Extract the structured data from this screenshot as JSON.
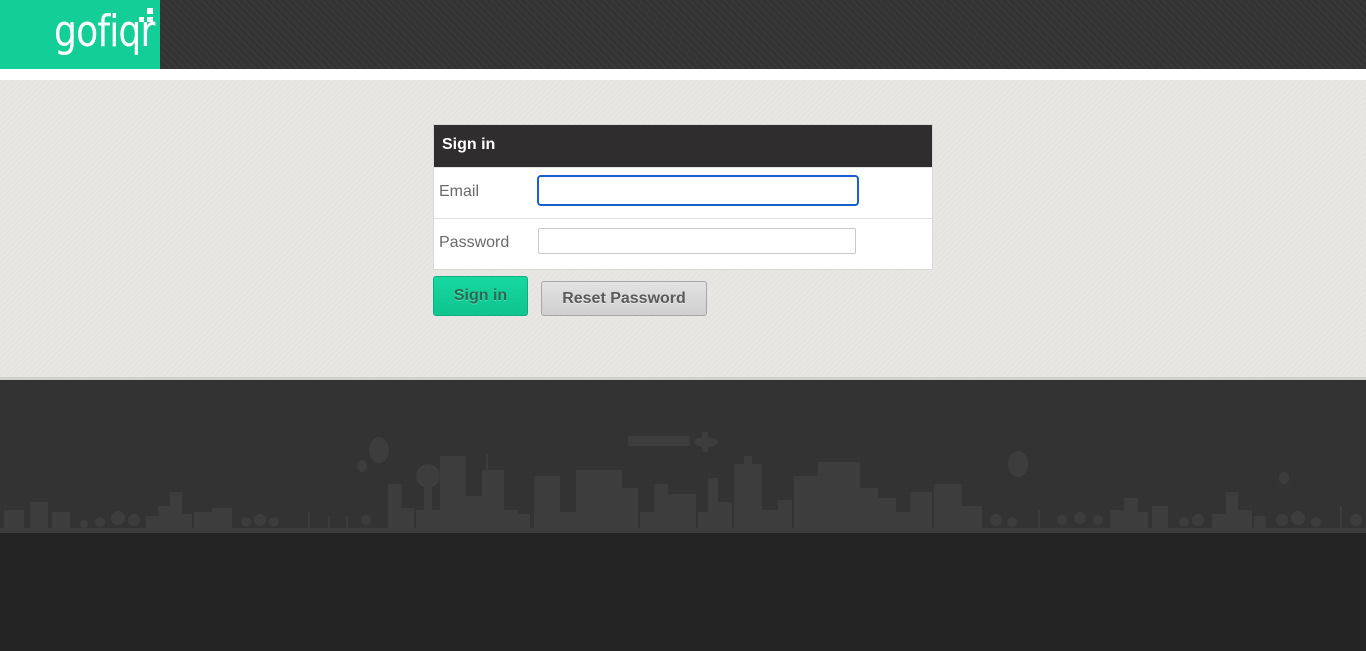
{
  "header": {
    "logo_text": "gofiqr",
    "brand_color": "#13cf97"
  },
  "login": {
    "title": "Sign in",
    "email_label": "Email",
    "email_value": "",
    "password_label": "Password",
    "password_value": "",
    "signin_label": "Sign in",
    "reset_label": "Reset Password"
  },
  "colors": {
    "header_bg": "#333333",
    "panel_header_bg": "#2f2d2d",
    "content_bg": "#e8e7e4",
    "footer_bg": "#333333",
    "footer_ground": "#242424",
    "focus_ring": "#1a5fd0"
  },
  "icons": {
    "logo_mark": "gofiqr-logo-icon",
    "skyline": "city-skyline-icon"
  }
}
